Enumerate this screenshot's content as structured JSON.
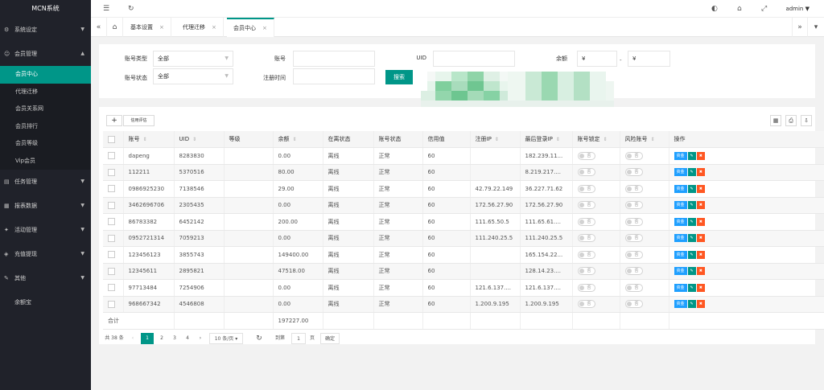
{
  "app": {
    "title": "MCN系统"
  },
  "sidebar": {
    "groups": [
      {
        "label": "系统设定"
      },
      {
        "label": "会员管理"
      },
      {
        "label": "任务管理"
      },
      {
        "label": "报表数据"
      },
      {
        "label": "活动管理"
      },
      {
        "label": "充值提现"
      },
      {
        "label": "其他"
      },
      {
        "label": "余额宝"
      }
    ],
    "member_items": [
      "会员中心",
      "代理迁移",
      "会员关系网",
      "会员排行",
      "会员等级",
      "Vip会员"
    ]
  },
  "header": {
    "user": "admin"
  },
  "tabs": [
    {
      "label": "基本设置",
      "close": "×"
    },
    {
      "label": "代理迁移",
      "close": "×"
    },
    {
      "label": "会员中心",
      "close": "×"
    }
  ],
  "filters": {
    "account_type_label": "账号类型",
    "account_type_value": "全部",
    "account_label": "账号",
    "uid_label": "UID",
    "balance_label": "余额",
    "balance_min": "¥",
    "balance_max": "¥",
    "balance_sep": "-",
    "account_status_label": "账号状态",
    "account_status_value": "全部",
    "reg_time_label": "注册时间",
    "search_button": "搜索"
  },
  "toolbar": {
    "add": "+",
    "credit": "信用评估"
  },
  "table": {
    "columns": [
      "账号",
      "UID",
      "等级",
      "余额",
      "在离状态",
      "账号状态",
      "信用值",
      "注册IP",
      "最后登录IP",
      "账号锁定",
      "风险账号",
      "操作"
    ],
    "switch_off": "否",
    "op_fund": "资金",
    "rows": [
      {
        "account": "dapeng",
        "uid": "8283830",
        "level": "",
        "balance": "0.00",
        "online": "离线",
        "status": "正常",
        "credit": "60",
        "reg_ip": "",
        "last_ip": "182.239.11..."
      },
      {
        "account": "112211",
        "uid": "5370516",
        "level": "",
        "balance": "80.00",
        "online": "离线",
        "status": "正常",
        "credit": "60",
        "reg_ip": "",
        "last_ip": "8.219.217...."
      },
      {
        "account": "0986925230",
        "uid": "7138546",
        "level": "",
        "balance": "29.00",
        "online": "离线",
        "status": "正常",
        "credit": "60",
        "reg_ip": "42.79.22.149",
        "last_ip": "36.227.71.62"
      },
      {
        "account": "3462696706",
        "uid": "2305435",
        "level": "",
        "balance": "0.00",
        "online": "离线",
        "status": "正常",
        "credit": "60",
        "reg_ip": "172.56.27.90",
        "last_ip": "172.56.27.90"
      },
      {
        "account": "86783382",
        "uid": "6452142",
        "level": "",
        "balance": "200.00",
        "online": "离线",
        "status": "正常",
        "credit": "60",
        "reg_ip": "111.65.50.5",
        "last_ip": "111.65.61...."
      },
      {
        "account": "0952721314",
        "uid": "7059213",
        "level": "",
        "balance": "0.00",
        "online": "离线",
        "status": "正常",
        "credit": "60",
        "reg_ip": "111.240.25.5",
        "last_ip": "111.240.25.5"
      },
      {
        "account": "123456123",
        "uid": "3855743",
        "level": "",
        "balance": "149400.00",
        "online": "离线",
        "status": "正常",
        "credit": "60",
        "reg_ip": "",
        "last_ip": "165.154.22..."
      },
      {
        "account": "12345611",
        "uid": "2895821",
        "level": "",
        "balance": "47518.00",
        "online": "离线",
        "status": "正常",
        "credit": "60",
        "reg_ip": "",
        "last_ip": "128.14.23...."
      },
      {
        "account": "97713484",
        "uid": "7254906",
        "level": "",
        "balance": "0.00",
        "online": "离线",
        "status": "正常",
        "credit": "60",
        "reg_ip": "121.6.137....",
        "last_ip": "121.6.137...."
      },
      {
        "account": "968667342",
        "uid": "4546808",
        "level": "",
        "balance": "0.00",
        "online": "离线",
        "status": "正常",
        "credit": "60",
        "reg_ip": "1.200.9.195",
        "last_ip": "1.200.9.195"
      }
    ],
    "total_label": "合计",
    "total_balance": "197227.00"
  },
  "pagination": {
    "total": "共 38 条",
    "pages": [
      "1",
      "2",
      "3",
      "4"
    ],
    "page_size": "10 条/页",
    "goto_label": "到第",
    "goto_value": "1",
    "page_unit": "页",
    "confirm": "确定"
  }
}
